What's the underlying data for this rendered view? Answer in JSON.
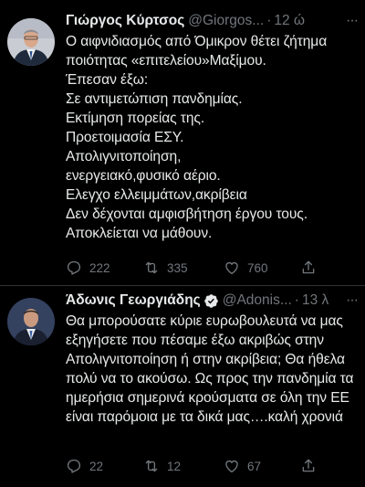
{
  "tweets": [
    {
      "name": "Γιώργος Κύρτσος",
      "handle": "@Giorgos...",
      "time": "12 ώ",
      "menu": "···",
      "text": "Ο αιφνιδιασμός από Όμικρον θέτει ζήτημα ποιότητας «επιτελείου»Μαξίμου.\nΈπεσαν έξω:\nΣε αντιμετώπιση πανδημίας.\nΕκτίμηση πορείας της.\nΠροετοιμασία ΕΣΥ.\nΑπολιγνιτοποίηση,\nενεργειακό,φυσικό αέριο.\nΕλεγχο ελλειμμάτων,ακρίβεια\nΔεν δέχονται αμφισβήτηση έργου τους.\nΑποκλείεται να μάθουν.",
      "replies": "222",
      "retweets": "335",
      "likes": "760",
      "verified": false
    },
    {
      "name": "Άδωνις Γεωργιάδης",
      "handle": "@Adonis...",
      "time": "13 λ",
      "menu": "···",
      "text": "Θα μπορούσατε κύριε ευρωβουλευτά να μας εξηγήσετε που πέσαμε έξω ακριβώς στην Απολιγνιτοποίηση ή στην ακρίβεια; Θα ήθελα πολύ να το ακούσω. Ως προς την πανδημία τα ημερήσια σημερινά κρούσματα σε όλη την ΕΕ είναι παρόμοια με τα δικά μας….καλή χρονιά",
      "replies": "22",
      "retweets": "12",
      "likes": "67",
      "verified": true
    }
  ],
  "colors": {
    "background": "#000000",
    "text": "#e7e9ea",
    "secondary": "#71767b",
    "verified": "#1d9bf0"
  }
}
